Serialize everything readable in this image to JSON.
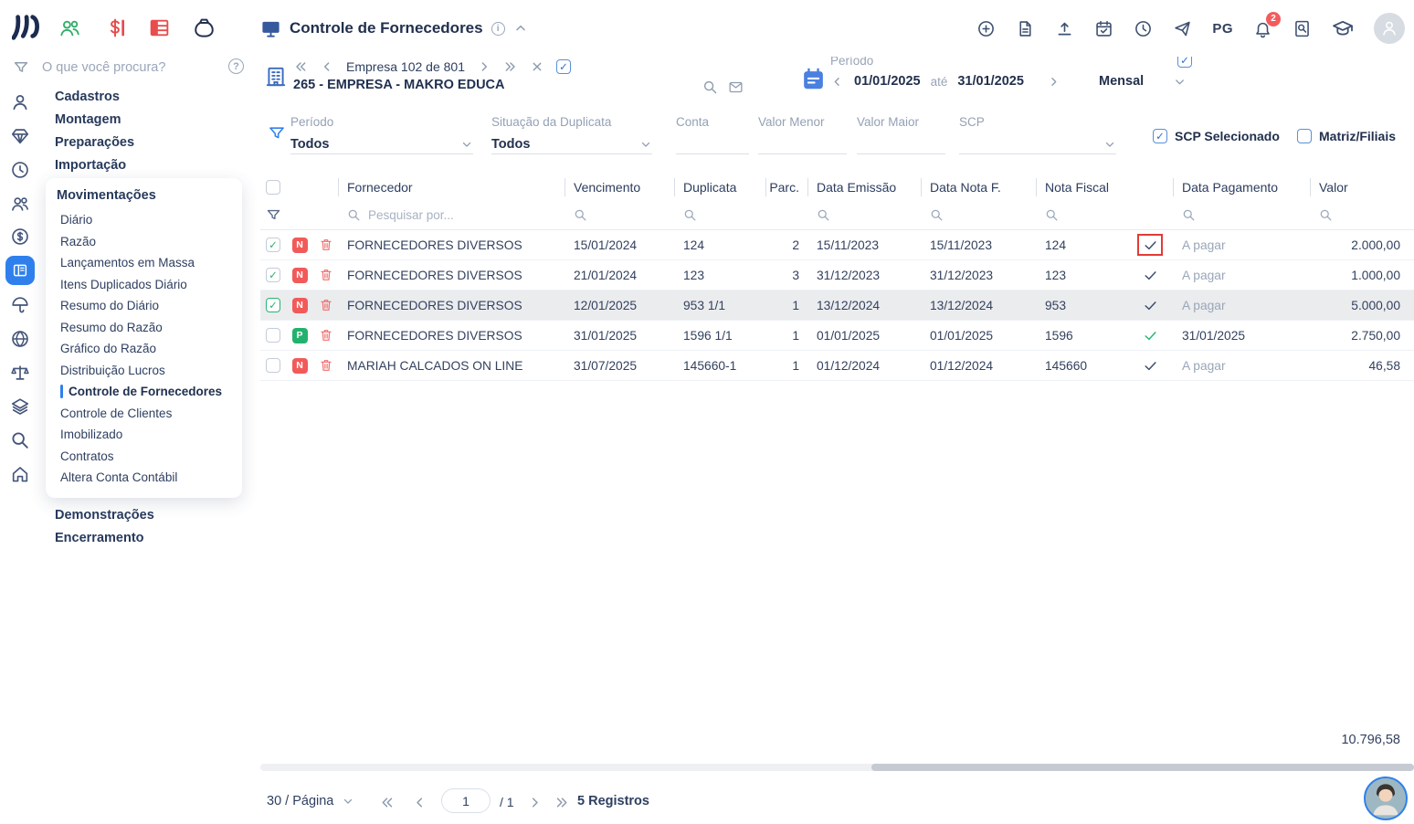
{
  "topbar": {
    "title": "Controle de Fornecedores",
    "pg_label": "PG",
    "notifications_count": "2"
  },
  "sidebar": {
    "search_placeholder": "O que você procura?",
    "items_top": [
      "Cadastros",
      "Montagem",
      "Preparações",
      "Importação"
    ],
    "movimentacoes": {
      "label": "Movimentações",
      "items": [
        "Diário",
        "Razão",
        "Lançamentos em Massa",
        "Itens Duplicados Diário",
        "Resumo do Diário",
        "Resumo do Razão",
        "Gráfico do Razão",
        "Distribuição Lucros",
        "Controle de Fornecedores",
        "Controle de Clientes",
        "Imobilizado",
        "Contratos",
        "Altera Conta Contábil"
      ],
      "active_item": "Controle de Fornecedores"
    },
    "items_bottom": [
      "Demonstrações",
      "Encerramento"
    ]
  },
  "company": {
    "nav_label": "Empresa 102 de 801",
    "name": "265 - EMPRESA - MAKRO EDUCA",
    "nav_checked": "true"
  },
  "period": {
    "label": "Período",
    "start": "01/01/2025",
    "until": "até",
    "end": "31/01/2025",
    "mode": "Mensal",
    "checked": "true"
  },
  "filters": {
    "periodo": {
      "label": "Período",
      "value": "Todos"
    },
    "situacao": {
      "label": "Situação da Duplicata",
      "value": "Todos"
    },
    "conta_label": "Conta",
    "valor_menor_label": "Valor Menor",
    "valor_maior_label": "Valor Maior",
    "scp_label": "SCP",
    "scp_selecionado": {
      "label": "SCP Selecionado",
      "checked": "true"
    },
    "matriz_filiais": {
      "label": "Matriz/Filiais",
      "checked": "false"
    }
  },
  "table": {
    "headers": {
      "fornecedor": "Fornecedor",
      "vencimento": "Vencimento",
      "duplicata": "Duplicata",
      "parc": "Parc.",
      "emissao": "Data Emissão",
      "nota_f": "Data Nota F.",
      "nota_fiscal": "Nota Fiscal",
      "pagamento": "Data Pagamento",
      "valor": "Valor"
    },
    "search_placeholder": "Pesquisar por...",
    "rows": [
      {
        "selected": "true",
        "focus": "false",
        "row_state": "normal",
        "badge": "N",
        "badge_type": "n",
        "fornecedor": "FORNECEDORES DIVERSOS",
        "vencimento": "15/01/2024",
        "duplicata": "124",
        "parc": "2",
        "emissao": "15/11/2023",
        "nota_f": "15/11/2023",
        "nota_fiscal": "124",
        "check": "dark",
        "annotated": "true",
        "pagamento": "A pagar",
        "pagamento_state": "pending",
        "valor": "2.000,00"
      },
      {
        "selected": "true",
        "focus": "false",
        "row_state": "normal",
        "badge": "N",
        "badge_type": "n",
        "fornecedor": "FORNECEDORES DIVERSOS",
        "vencimento": "21/01/2024",
        "duplicata": "123",
        "parc": "3",
        "emissao": "31/12/2023",
        "nota_f": "31/12/2023",
        "nota_fiscal": "123",
        "check": "dark",
        "annotated": "false",
        "pagamento": "A pagar",
        "pagamento_state": "pending",
        "valor": "1.000,00"
      },
      {
        "selected": "true",
        "focus": "true",
        "row_state": "selected",
        "badge": "N",
        "badge_type": "n",
        "fornecedor": "FORNECEDORES DIVERSOS",
        "vencimento": "12/01/2025",
        "duplicata": "953 1/1",
        "parc": "1",
        "emissao": "13/12/2024",
        "nota_f": "13/12/2024",
        "nota_fiscal": "953",
        "check": "dark",
        "annotated": "false",
        "pagamento": "A pagar",
        "pagamento_state": "pending",
        "valor": "5.000,00"
      },
      {
        "selected": "false",
        "focus": "false",
        "row_state": "normal",
        "badge": "P",
        "badge_type": "p",
        "fornecedor": "FORNECEDORES DIVERSOS",
        "vencimento": "31/01/2025",
        "duplicata": "1596 1/1",
        "parc": "1",
        "emissao": "01/01/2025",
        "nota_f": "01/01/2025",
        "nota_fiscal": "1596",
        "check": "green",
        "annotated": "false",
        "pagamento": "31/01/2025",
        "pagamento_state": "paid",
        "valor": "2.750,00"
      },
      {
        "selected": "false",
        "focus": "false",
        "row_state": "normal",
        "badge": "N",
        "badge_type": "n",
        "fornecedor": "MARIAH CALCADOS ON LINE",
        "vencimento": "31/07/2025",
        "duplicata": "145660-1",
        "parc": "1",
        "emissao": "01/12/2024",
        "nota_f": "01/12/2024",
        "nota_fiscal": "145660",
        "check": "dark",
        "annotated": "false",
        "pagamento": "A pagar",
        "pagamento_state": "pending",
        "valor": "46,58"
      }
    ],
    "total": "10.796,58"
  },
  "pagination": {
    "per_page": "30 / Página",
    "page": "1",
    "of_pages": "/ 1",
    "records": "5 Registros"
  }
}
